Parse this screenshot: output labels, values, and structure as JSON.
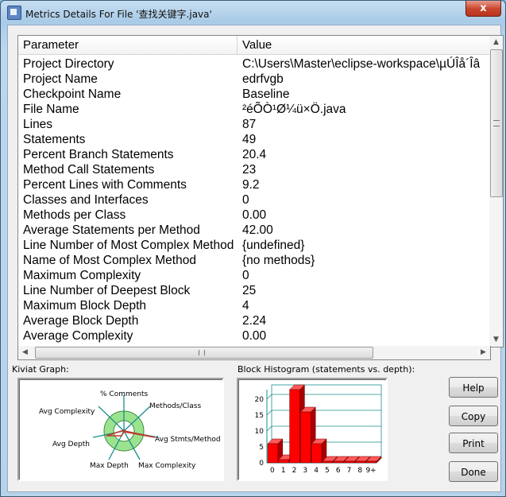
{
  "window": {
    "title": "Metrics Details For File '查找关键字.java'",
    "close_label": "x"
  },
  "table": {
    "headers": [
      "Parameter",
      "Value"
    ],
    "rows": [
      {
        "parameter": "Project Directory",
        "value": "C:\\Users\\Master\\eclipse-workspace\\µÚÎå´Îâ"
      },
      {
        "parameter": "Project Name",
        "value": "edrfvgb"
      },
      {
        "parameter": "Checkpoint Name",
        "value": "Baseline"
      },
      {
        "parameter": "File Name",
        "value": "²éÕÒ¹Ø¼ü×Ö.java"
      },
      {
        "parameter": "Lines",
        "value": "87"
      },
      {
        "parameter": "Statements",
        "value": "49"
      },
      {
        "parameter": "Percent Branch Statements",
        "value": "20.4"
      },
      {
        "parameter": "Method Call Statements",
        "value": "23"
      },
      {
        "parameter": "Percent Lines with Comments",
        "value": "9.2"
      },
      {
        "parameter": "Classes and Interfaces",
        "value": "0"
      },
      {
        "parameter": "Methods per Class",
        "value": "0.00"
      },
      {
        "parameter": "Average Statements per Method",
        "value": "42.00"
      },
      {
        "parameter": "Line Number of Most Complex Method",
        "value": "{undefined}"
      },
      {
        "parameter": "Name of Most Complex Method",
        "value": "{no methods}"
      },
      {
        "parameter": "Maximum Complexity",
        "value": "0"
      },
      {
        "parameter": "Line Number of Deepest Block",
        "value": "25"
      },
      {
        "parameter": "Maximum Block Depth",
        "value": "4"
      },
      {
        "parameter": "Average Block Depth",
        "value": "2.24"
      },
      {
        "parameter": "Average Complexity",
        "value": "0.00"
      }
    ]
  },
  "kiviat": {
    "label": "Kiviat Graph:",
    "axes": [
      "% Comments",
      "Methods/Class",
      "Avg Stmts/Method",
      "Max Complexity",
      "Max Depth",
      "Avg Depth",
      "Avg Complexity"
    ],
    "colors": {
      "band": "#9be38f",
      "axis": "#1a8f8f",
      "plot": "#c0392b"
    }
  },
  "histogram": {
    "label": "Block Histogram (statements vs. depth):",
    "bar_color": "#ff0000"
  },
  "buttons": {
    "help": "Help",
    "copy": "Copy",
    "print": "Print",
    "done": "Done"
  },
  "chart_data": {
    "type": "bar",
    "title": "Block Histogram (statements vs. depth):",
    "categories": [
      "0",
      "1",
      "2",
      "3",
      "4",
      "5",
      "6",
      "7",
      "8",
      "9+"
    ],
    "values": [
      6,
      1,
      23,
      16,
      6,
      0,
      0,
      0,
      0,
      0
    ],
    "y_ticks": [
      0,
      5,
      10,
      15,
      20
    ],
    "ylim": [
      0,
      23
    ],
    "grid": true
  }
}
